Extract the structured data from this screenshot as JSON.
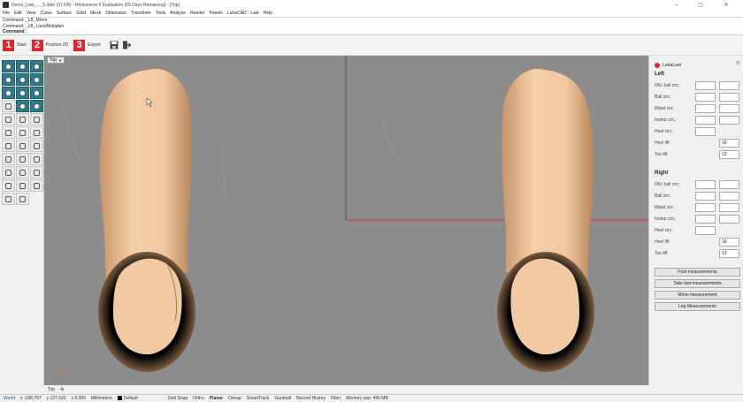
{
  "window": {
    "title": "Demo_Last_..._5.3dm (37 KB) - Rhinoceros 6 Evaluation (55 Days Remaining) - [Top]",
    "minimize": "–",
    "maximize": "▢",
    "close": "✕"
  },
  "menu": [
    "File",
    "Edit",
    "View",
    "Curve",
    "Surface",
    "Solid",
    "Mesh",
    "Dimension",
    "Transform",
    "Tools",
    "Analyze",
    "Render",
    "Panels",
    "LutraCAD - Last",
    "Help"
  ],
  "command": {
    "history1": "Command: _LB_Mirror",
    "history2": "Command: _LB_LoesAfstrijden",
    "prompt": "Command:"
  },
  "steps": [
    {
      "num": "1",
      "label": "Start"
    },
    {
      "num": "2",
      "label": "Position 2D"
    },
    {
      "num": "3",
      "label": "Export"
    }
  ],
  "viewport": {
    "name": "Top",
    "axis_color": "#d8313b",
    "skin_color": "#f1c9a2"
  },
  "panel": {
    "name": "LutraLast",
    "left_title": "Left",
    "right_title": "Right",
    "fields": [
      "Obl. ball circ.",
      "Ball circ.",
      "Waist circ.",
      "Instep circ.",
      "Heel circ."
    ],
    "heel_lift_label": "Heel lift",
    "toe_lift_label": "Toe lift",
    "left_heel_lift": "16",
    "left_toe_lift": "13",
    "right_heel_lift": "16",
    "right_toe_lift": "13",
    "buttons": [
      "Foot measurements",
      "Take last measurements",
      "Move measurement",
      "Leg Measurements"
    ]
  },
  "viewtabs": {
    "active": "Top",
    "add": "⊕"
  },
  "status": {
    "cplane": "World",
    "x": "x -198,797",
    "y": "y 127,633",
    "z": "z 0,000",
    "units": "Millimeters",
    "layer": "Default",
    "items": [
      "Grid Snap",
      "Ortho",
      "Planar",
      "Osnap",
      "SmartTrack",
      "Gumball",
      "Record History",
      "Filter",
      "Memory use: 490 MB"
    ],
    "bold_item": "Planar"
  }
}
